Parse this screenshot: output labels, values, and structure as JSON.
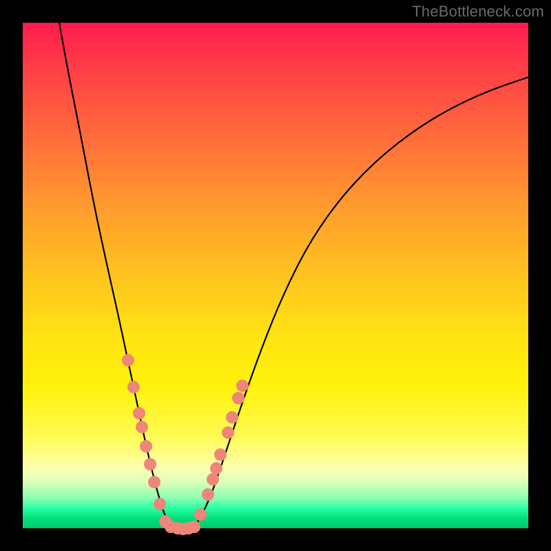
{
  "watermark": "TheBottleneck.com",
  "colors": {
    "curve_stroke": "#000000",
    "dot_fill": "#ee8679",
    "dot_stroke": "#c9584e"
  },
  "chart_data": {
    "type": "line",
    "title": "",
    "xlabel": "",
    "ylabel": "",
    "xlim": [
      33,
      767
    ],
    "ylim": [
      767,
      33
    ],
    "grid": false,
    "series": [
      {
        "name": "left-curve",
        "values": [
          [
            86,
            33
          ],
          [
            100,
            110
          ],
          [
            116,
            190
          ],
          [
            135,
            290
          ],
          [
            152,
            370
          ],
          [
            170,
            450
          ],
          [
            185,
            520
          ],
          [
            200,
            590
          ],
          [
            215,
            660
          ],
          [
            225,
            700
          ],
          [
            233,
            730
          ],
          [
            242,
            755
          ],
          [
            250,
            765
          ]
        ]
      },
      {
        "name": "right-curve",
        "values": [
          [
            282,
            765
          ],
          [
            292,
            750
          ],
          [
            306,
            720
          ],
          [
            320,
            680
          ],
          [
            335,
            635
          ],
          [
            355,
            575
          ],
          [
            380,
            505
          ],
          [
            410,
            430
          ],
          [
            450,
            350
          ],
          [
            500,
            280
          ],
          [
            560,
            220
          ],
          [
            630,
            170
          ],
          [
            700,
            135
          ],
          [
            767,
            112
          ]
        ]
      },
      {
        "name": "bottom-arc",
        "values": [
          [
            250,
            765
          ],
          [
            258,
            767
          ],
          [
            266,
            768
          ],
          [
            274,
            767
          ],
          [
            282,
            765
          ]
        ]
      }
    ],
    "dots": [
      [
        186,
        523
      ],
      [
        194,
        562
      ],
      [
        202,
        600
      ],
      [
        206,
        620
      ],
      [
        212,
        648
      ],
      [
        218,
        674
      ],
      [
        224,
        700
      ],
      [
        232,
        732
      ],
      [
        240,
        757
      ],
      [
        248,
        765
      ],
      [
        258,
        767
      ],
      [
        266,
        768
      ],
      [
        274,
        767
      ],
      [
        282,
        765
      ],
      [
        291,
        747
      ],
      [
        302,
        718
      ],
      [
        309,
        696
      ],
      [
        314,
        680
      ],
      [
        320,
        660
      ],
      [
        331,
        628
      ],
      [
        337,
        606
      ],
      [
        346,
        578
      ],
      [
        352,
        560
      ]
    ],
    "dot_radius": 9
  }
}
